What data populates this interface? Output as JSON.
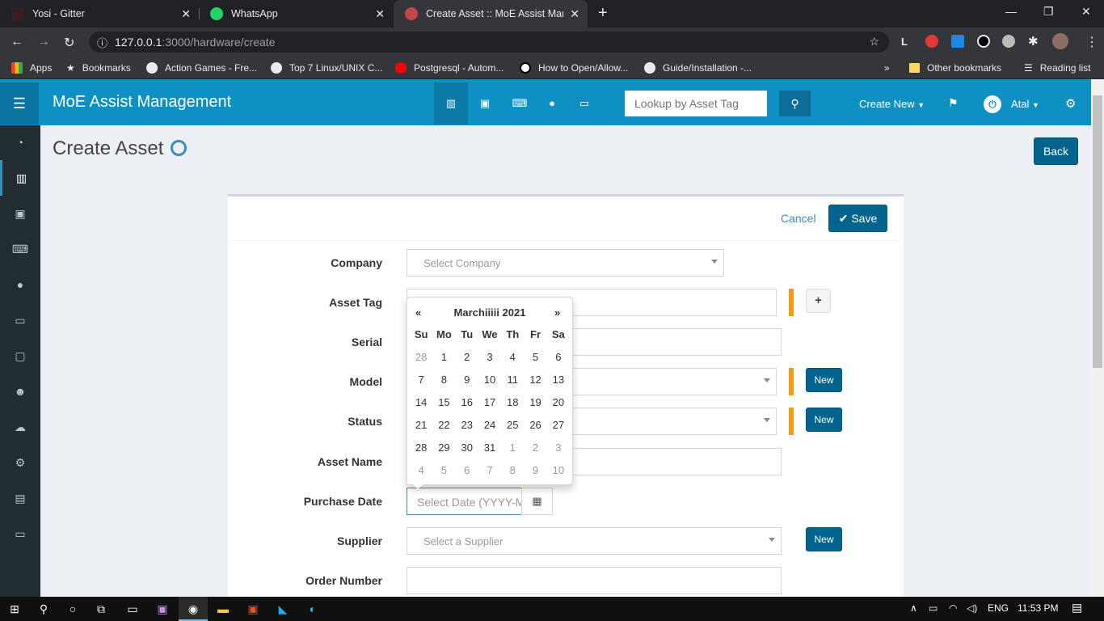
{
  "browser": {
    "tabs": [
      {
        "title": "Yosi - Gitter",
        "icon": "gitter-icon"
      },
      {
        "title": "WhatsApp",
        "icon": "whatsapp-icon"
      },
      {
        "title": "Create Asset :: MoE Assist Manag",
        "icon": "app-favicon"
      }
    ],
    "url_host": "127.0.0.1",
    "url_path": ":3000/hardware/create",
    "bookmarks": [
      "Apps",
      "Bookmarks",
      "Action Games - Fre...",
      "Top 7 Linux/UNIX C...",
      "Postgresql - Autom...",
      "How to Open/Allow...",
      "Guide/Installation -..."
    ],
    "other_bookmarks": "Other bookmarks",
    "reading_list": "Reading list",
    "profile_letter": "L"
  },
  "header": {
    "brand": "MoE Assist Management",
    "lookup_placeholder": "Lookup by Asset Tag",
    "create_new": "Create New",
    "user": "Atal"
  },
  "page": {
    "title": "Create Asset",
    "back": "Back",
    "cancel": "Cancel",
    "save": "Save"
  },
  "form": {
    "company_label": "Company",
    "company_placeholder": "Select Company",
    "asset_tag_label": "Asset Tag",
    "serial_label": "Serial",
    "model_label": "Model",
    "status_label": "Status",
    "asset_name_label": "Asset Name",
    "purchase_date_label": "Purchase Date",
    "purchase_date_placeholder": "Select Date (YYYY-MM-DD)",
    "supplier_label": "Supplier",
    "supplier_placeholder": "Select a Supplier",
    "order_number_label": "Order Number",
    "new_label": "New",
    "plus_label": "+"
  },
  "datepicker": {
    "prev": "«",
    "next": "»",
    "title": "Marchiiiii 2021",
    "dow": [
      "Su",
      "Mo",
      "Tu",
      "We",
      "Th",
      "Fr",
      "Sa"
    ],
    "weeks": [
      [
        "28",
        "1",
        "2",
        "3",
        "4",
        "5",
        "6"
      ],
      [
        "7",
        "8",
        "9",
        "10",
        "11",
        "12",
        "13"
      ],
      [
        "14",
        "15",
        "16",
        "17",
        "18",
        "19",
        "20"
      ],
      [
        "21",
        "22",
        "23",
        "24",
        "25",
        "26",
        "27"
      ],
      [
        "28",
        "29",
        "30",
        "31",
        "1",
        "2",
        "3"
      ],
      [
        "4",
        "5",
        "6",
        "7",
        "8",
        "9",
        "10"
      ]
    ]
  },
  "taskbar": {
    "lang": "ENG",
    "time": "11:53 PM"
  },
  "colors": {
    "header": "#0e90c3",
    "sidebar": "#222d32",
    "primary_button": "#00648c",
    "required": "#f39c12"
  }
}
